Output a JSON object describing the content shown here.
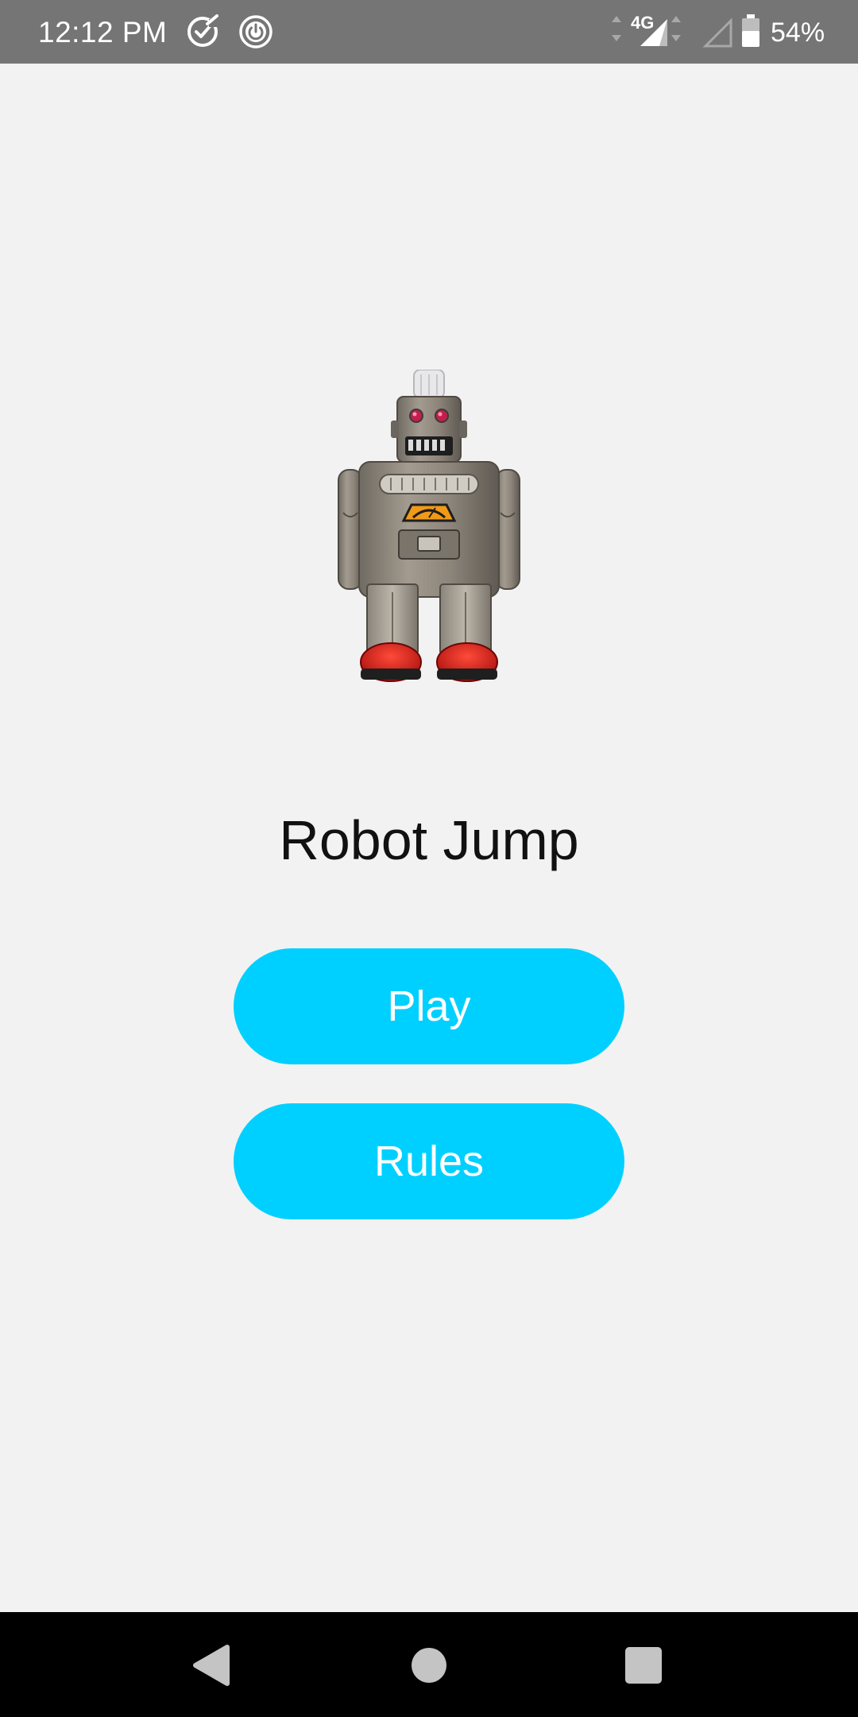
{
  "status_bar": {
    "time": "12:12 PM",
    "icons": [
      "check-circle-icon",
      "power-icon",
      "data-arrows-icon",
      "network-4g-icon",
      "signal-icon",
      "battery-icon"
    ],
    "network_label": "4G",
    "battery_percent": "54%",
    "battery_level": 0.54
  },
  "main": {
    "image": "robot-image",
    "title": "Robot Jump",
    "buttons": {
      "play_label": "Play",
      "rules_label": "Rules"
    },
    "accent_color": "#00d0ff"
  },
  "nav_bar": {
    "icons": [
      "back-icon",
      "home-icon",
      "recents-icon"
    ]
  }
}
